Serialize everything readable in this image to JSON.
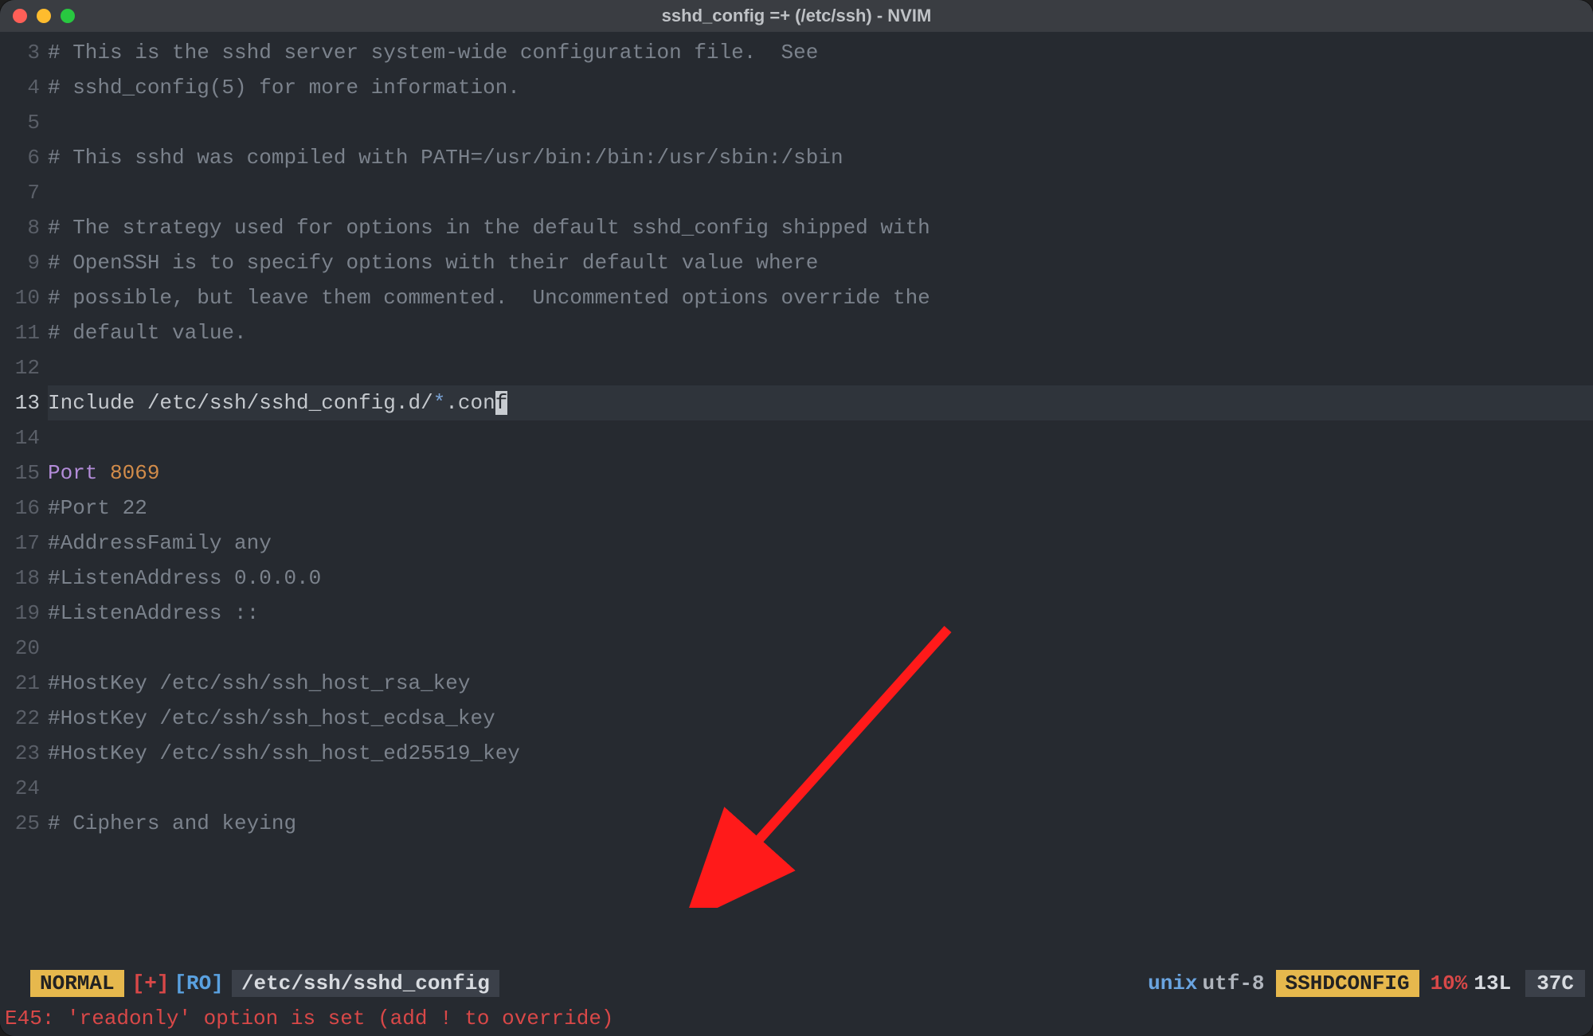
{
  "window": {
    "title": "sshd_config =+ (/etc/ssh) - NVIM"
  },
  "lines": [
    {
      "n": "3",
      "current": false,
      "seg": [
        [
          "comment",
          "# This is the sshd server system-wide configuration file.  See"
        ]
      ]
    },
    {
      "n": "4",
      "current": false,
      "seg": [
        [
          "comment",
          "# sshd_config(5) for more information."
        ]
      ]
    },
    {
      "n": "5",
      "current": false,
      "seg": []
    },
    {
      "n": "6",
      "current": false,
      "seg": [
        [
          "comment",
          "# This sshd was compiled with PATH=/usr/bin:/bin:/usr/sbin:/sbin"
        ]
      ]
    },
    {
      "n": "7",
      "current": false,
      "seg": []
    },
    {
      "n": "8",
      "current": false,
      "seg": [
        [
          "comment",
          "# The strategy used for options in the default sshd_config shipped with"
        ]
      ]
    },
    {
      "n": "9",
      "current": false,
      "seg": [
        [
          "comment",
          "# OpenSSH is to specify options with their default value where"
        ]
      ]
    },
    {
      "n": "10",
      "current": false,
      "seg": [
        [
          "comment",
          "# possible, but leave them commented.  Uncommented options override the"
        ]
      ]
    },
    {
      "n": "11",
      "current": false,
      "seg": [
        [
          "comment",
          "# default value."
        ]
      ]
    },
    {
      "n": "12",
      "current": false,
      "seg": []
    },
    {
      "n": "13",
      "current": true,
      "seg": [
        [
          "path",
          "Include /etc/ssh/sshd_config.d/"
        ],
        [
          "star",
          "*"
        ],
        [
          "path",
          ".con"
        ],
        [
          "cursor",
          "f"
        ]
      ]
    },
    {
      "n": "14",
      "current": false,
      "seg": []
    },
    {
      "n": "15",
      "current": false,
      "seg": [
        [
          "keyword",
          "Port "
        ],
        [
          "number",
          "8069"
        ]
      ]
    },
    {
      "n": "16",
      "current": false,
      "seg": [
        [
          "comment",
          "#Port 22"
        ]
      ]
    },
    {
      "n": "17",
      "current": false,
      "seg": [
        [
          "comment",
          "#AddressFamily any"
        ]
      ]
    },
    {
      "n": "18",
      "current": false,
      "seg": [
        [
          "comment",
          "#ListenAddress 0.0.0.0"
        ]
      ]
    },
    {
      "n": "19",
      "current": false,
      "seg": [
        [
          "comment",
          "#ListenAddress ::"
        ]
      ]
    },
    {
      "n": "20",
      "current": false,
      "seg": []
    },
    {
      "n": "21",
      "current": false,
      "seg": [
        [
          "comment",
          "#HostKey /etc/ssh/ssh_host_rsa_key"
        ]
      ]
    },
    {
      "n": "22",
      "current": false,
      "seg": [
        [
          "comment",
          "#HostKey /etc/ssh/ssh_host_ecdsa_key"
        ]
      ]
    },
    {
      "n": "23",
      "current": false,
      "seg": [
        [
          "comment",
          "#HostKey /etc/ssh/ssh_host_ed25519_key"
        ]
      ]
    },
    {
      "n": "24",
      "current": false,
      "seg": []
    },
    {
      "n": "25",
      "current": false,
      "seg": [
        [
          "comment",
          "# Ciphers and keying"
        ]
      ]
    }
  ],
  "status": {
    "mode": "NORMAL",
    "modified": "[+]",
    "readonly": "[RO]",
    "file": "/etc/ssh/sshd_config",
    "fileformat": "unix",
    "encoding": "utf-8",
    "filetype": "SSHDCONFIG",
    "percent": "10%",
    "line": "13L",
    "col": "37C"
  },
  "cmdline": "E45: 'readonly' option is set (add ! to override)"
}
